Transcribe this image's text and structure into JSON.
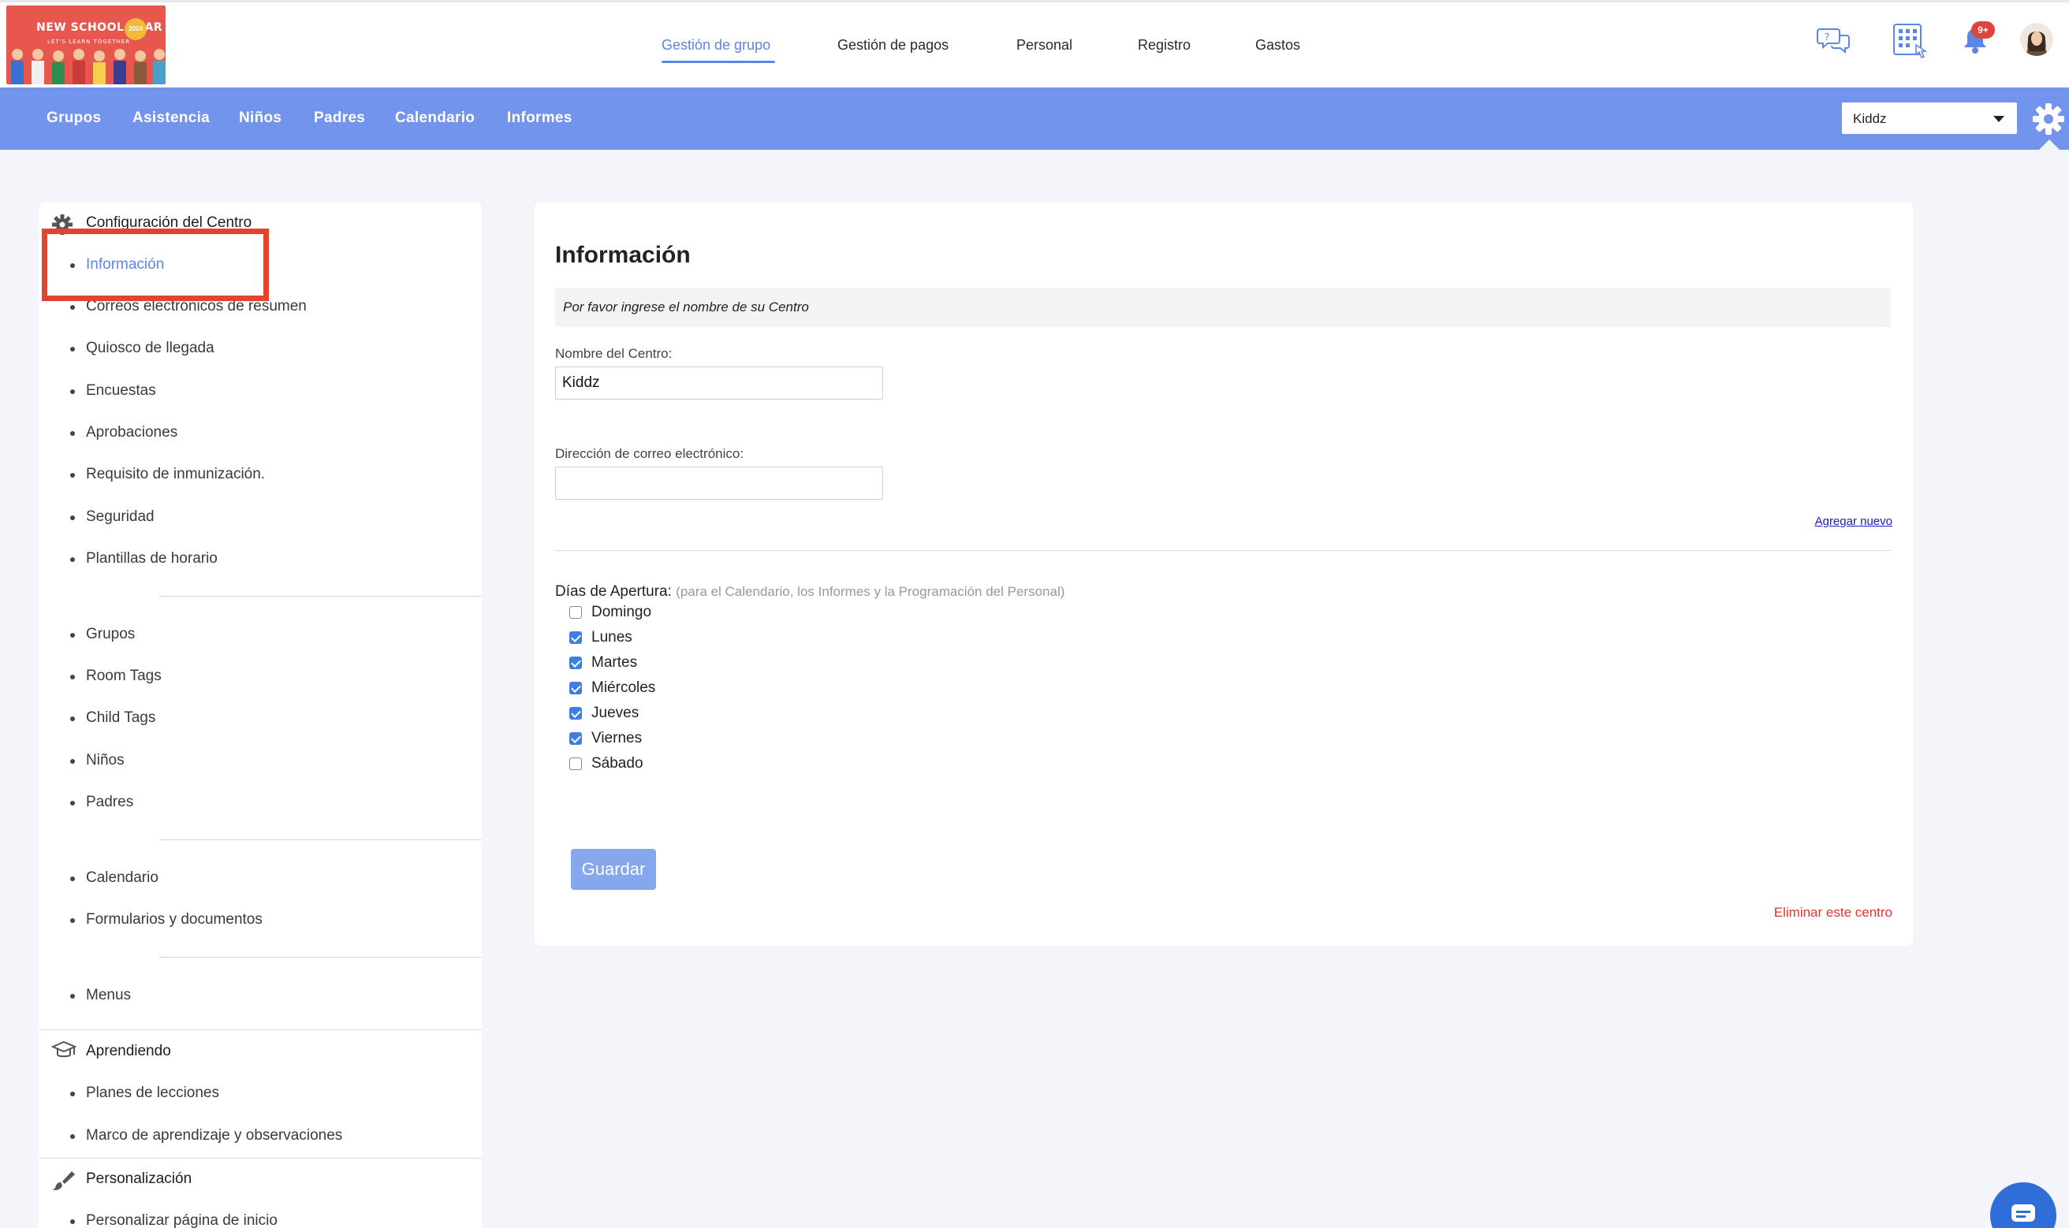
{
  "logo": {
    "line1": "NEW SCHOOL YEAR",
    "line2": "LET'S LEARN TOGETHER",
    "badge": "2024"
  },
  "topnav": {
    "items": [
      "Gestión de grupo",
      "Gestión de pagos",
      "Personal",
      "Registro",
      "Gastos"
    ],
    "active": 0
  },
  "top_icons": {
    "notifications_badge": "9+"
  },
  "subnav": {
    "items": [
      "Grupos",
      "Asistencia",
      "Niños",
      "Padres",
      "Calendario",
      "Informes"
    ]
  },
  "center_select": {
    "value": "Kiddz"
  },
  "sidebar": {
    "section1": {
      "title": "Configuración del Centro",
      "groups": [
        [
          "Información",
          "Correos electrónicos de resumen",
          "Quiosco de llegada",
          "Encuestas",
          "Aprobaciones",
          "Requisito de inmunización.",
          "Seguridad",
          "Plantillas de horario"
        ],
        [
          "Grupos",
          "Room Tags",
          "Child Tags",
          "Niños",
          "Padres"
        ],
        [
          "Calendario",
          "Formularios y documentos"
        ],
        [
          "Menus"
        ]
      ]
    },
    "section2": {
      "title": "Aprendiendo",
      "items": [
        "Planes de lecciones",
        "Marco de aprendizaje y observaciones"
      ]
    },
    "section3": {
      "title": "Personalización",
      "items": [
        "Personalizar página de inicio"
      ]
    }
  },
  "main": {
    "title": "Información",
    "notice": "Por favor ingrese el nombre de su Centro",
    "center_name_label": "Nombre del Centro:",
    "center_name_value": "Kiddz",
    "email_label": "Dirección de correo electrónico:",
    "email_value": "",
    "add_new": "Agregar nuevo",
    "days_label": "Días de Apertura:",
    "days_hint": "(para el Calendario, los Informes y la Programación del Personal)",
    "days": [
      {
        "name": "Domingo",
        "checked": false
      },
      {
        "name": "Lunes",
        "checked": true
      },
      {
        "name": "Martes",
        "checked": true
      },
      {
        "name": "Miércoles",
        "checked": true
      },
      {
        "name": "Jueves",
        "checked": true
      },
      {
        "name": "Viernes",
        "checked": true
      },
      {
        "name": "Sábado",
        "checked": false
      }
    ],
    "save": "Guardar",
    "delete": "Eliminar este centro"
  },
  "colors": {
    "accent": "#7294ec",
    "active_link": "#5a86e4",
    "danger": "#d83a2e",
    "highlight": "#e2442f"
  }
}
